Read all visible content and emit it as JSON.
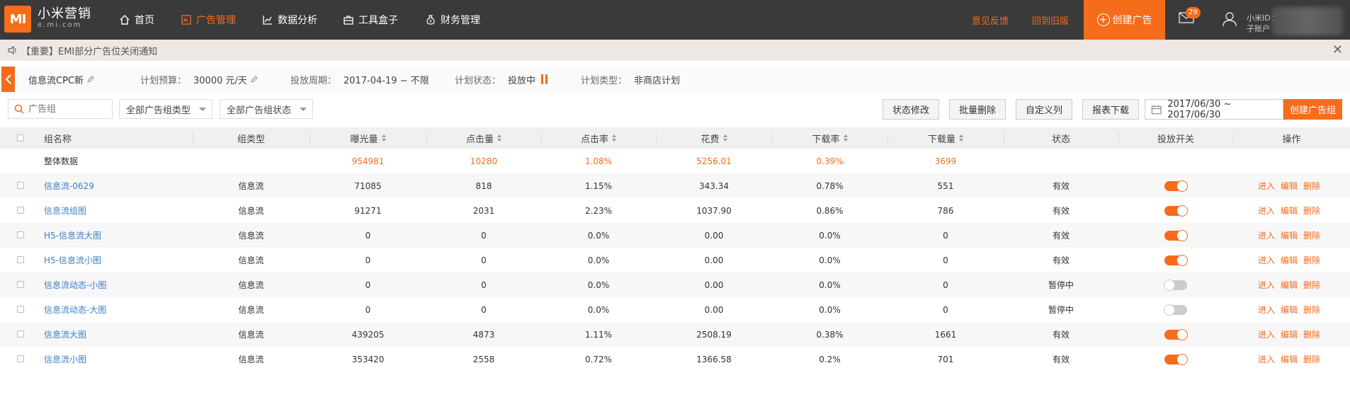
{
  "brand": {
    "logo": "MI",
    "title": "小米营销",
    "subtitle": "e.mi.com",
    "color": "#f56c1b"
  },
  "nav": [
    {
      "label": "首页",
      "icon": "home-icon"
    },
    {
      "label": "广告管理",
      "icon": "ad-manage-icon",
      "active": true
    },
    {
      "label": "数据分析",
      "icon": "chart-icon"
    },
    {
      "label": "工具盒子",
      "icon": "toolbox-icon"
    },
    {
      "label": "财务管理",
      "icon": "money-bag-icon"
    }
  ],
  "header_links": {
    "feedback": "意见反馈",
    "old_version": "回到旧版",
    "create_ad": "创建广告"
  },
  "mail_badge": "29",
  "user": {
    "id_label": "小米ID：",
    "sub_account": "子账户"
  },
  "notice": {
    "text": "【重要】EMI部分广告位关闭通知"
  },
  "plan": {
    "name": "信息流CPC新",
    "budget_label": "计划预算：",
    "budget_value": "30000 元/天",
    "period_label": "投放周期：",
    "period_value": "2017-04-19 ~ 不限",
    "status_label": "计划状态：",
    "status_value": "投放中",
    "type_label": "计划类型：",
    "type_value": "非商店计划"
  },
  "toolbar": {
    "search_placeholder": "广告组",
    "group_type": "全部广告组类型",
    "group_status": "全部广告组状态",
    "btn_status": "状态修改",
    "btn_delete": "批量删除",
    "btn_custom": "自定义列",
    "btn_download": "报表下载",
    "date_range": "2017/06/30 ~ 2017/06/30",
    "btn_create": "创建广告组"
  },
  "table": {
    "headers": {
      "name": "组名称",
      "type": "组类型",
      "impr": "曝光量",
      "clicks": "点击量",
      "ctr": "点击率",
      "cost": "花费",
      "dlrate": "下载率",
      "downloads": "下载量",
      "status": "状态",
      "switch": "投放开关",
      "ops": "操作"
    },
    "summary": {
      "label": "整体数据",
      "impr": "954981",
      "clicks": "10280",
      "ctr": "1.08%",
      "cost": "5256.01",
      "dlrate": "0.39%",
      "downloads": "3699"
    },
    "ops": {
      "enter": "进入",
      "edit": "编辑",
      "delete": "删除"
    },
    "rows": [
      {
        "name": "信息流-0629",
        "type": "信息流",
        "impr": "71085",
        "clicks": "818",
        "ctr": "1.15%",
        "cost": "343.34",
        "dlrate": "0.78%",
        "downloads": "551",
        "status": "有效",
        "on": true
      },
      {
        "name": "信息流组图",
        "type": "信息流",
        "impr": "91271",
        "clicks": "2031",
        "ctr": "2.23%",
        "cost": "1037.90",
        "dlrate": "0.86%",
        "downloads": "786",
        "status": "有效",
        "on": true
      },
      {
        "name": "H5-信息流大图",
        "type": "信息流",
        "impr": "0",
        "clicks": "0",
        "ctr": "0.0%",
        "cost": "0.00",
        "dlrate": "0.0%",
        "downloads": "0",
        "status": "有效",
        "on": true
      },
      {
        "name": "H5-信息流小图",
        "type": "信息流",
        "impr": "0",
        "clicks": "0",
        "ctr": "0.0%",
        "cost": "0.00",
        "dlrate": "0.0%",
        "downloads": "0",
        "status": "有效",
        "on": true
      },
      {
        "name": "信息流动态-小图",
        "type": "信息流",
        "impr": "0",
        "clicks": "0",
        "ctr": "0.0%",
        "cost": "0.00",
        "dlrate": "0.0%",
        "downloads": "0",
        "status": "暂停中",
        "on": false
      },
      {
        "name": "信息流动态-大图",
        "type": "信息流",
        "impr": "0",
        "clicks": "0",
        "ctr": "0.0%",
        "cost": "0.00",
        "dlrate": "0.0%",
        "downloads": "0",
        "status": "暂停中",
        "on": false
      },
      {
        "name": "信息流大图",
        "type": "信息流",
        "impr": "439205",
        "clicks": "4873",
        "ctr": "1.11%",
        "cost": "2508.19",
        "dlrate": "0.38%",
        "downloads": "1661",
        "status": "有效",
        "on": true
      },
      {
        "name": "信息流小图",
        "type": "信息流",
        "impr": "353420",
        "clicks": "2558",
        "ctr": "0.72%",
        "cost": "1366.58",
        "dlrate": "0.2%",
        "downloads": "701",
        "status": "有效",
        "on": true
      }
    ]
  }
}
